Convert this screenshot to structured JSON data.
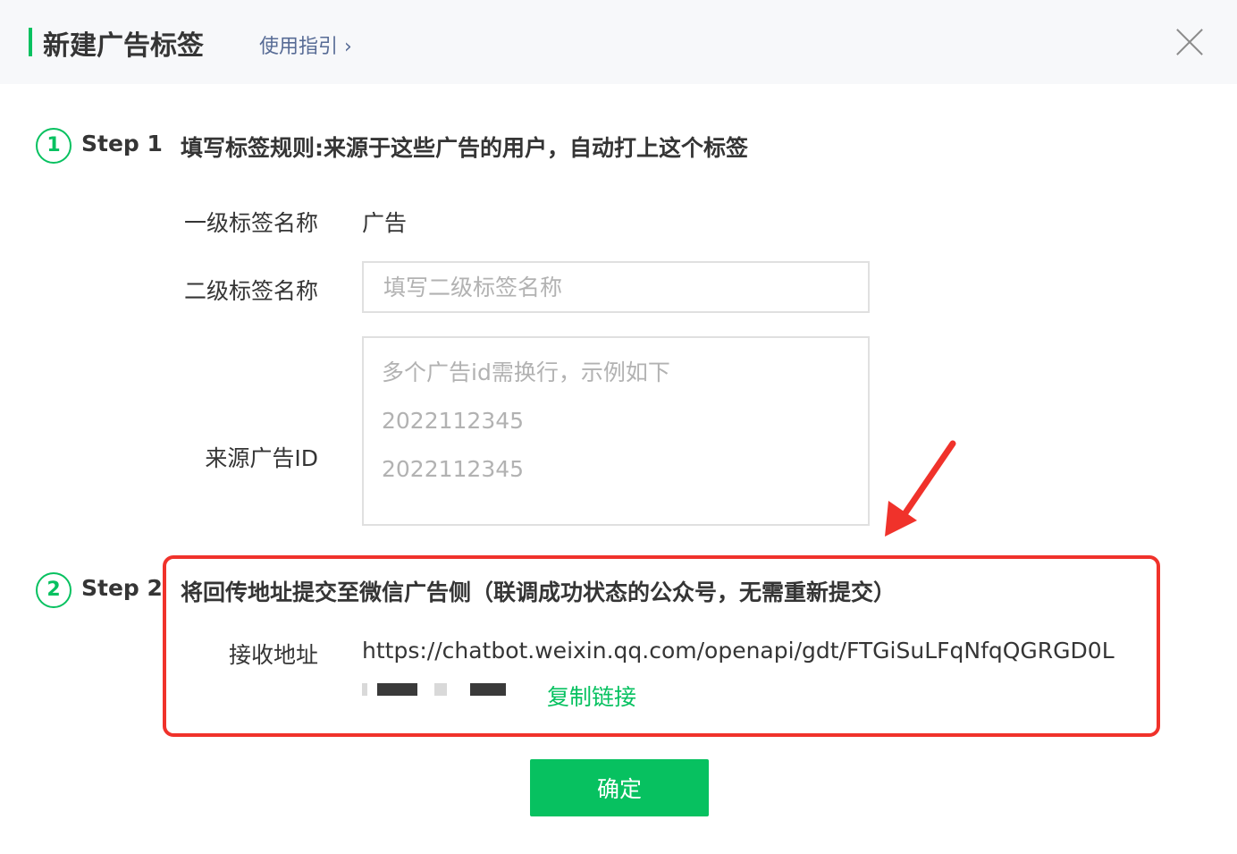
{
  "header": {
    "title": "新建广告标签",
    "guide_link": "使用指引 ›"
  },
  "step1": {
    "number": "1",
    "label": "Step 1",
    "description": "填写标签规则:来源于这些广告的用户，自动打上这个标签",
    "level1_label": "一级标签名称",
    "level1_value": "广告",
    "level2_label": "二级标签名称",
    "level2_placeholder": "填写二级标签名称",
    "ad_id_label": "来源广告ID",
    "ad_id_placeholder": "多个广告id需换行，示例如下\n2022112345\n2022112345"
  },
  "step2": {
    "number": "2",
    "label": "Step 2",
    "description": "将回传地址提交至微信广告侧（联调成功状态的公众号，无需重新提交）",
    "address_label": "接收地址",
    "address_value": "https://chatbot.weixin.qq.com/openapi/gdt/FTGiSuLFqNfqQGRGD0L",
    "copy_link": "复制链接"
  },
  "footer": {
    "confirm_label": "确定"
  },
  "colors": {
    "accent": "#07c160",
    "link": "#576b95",
    "highlight": "#f0322b"
  }
}
